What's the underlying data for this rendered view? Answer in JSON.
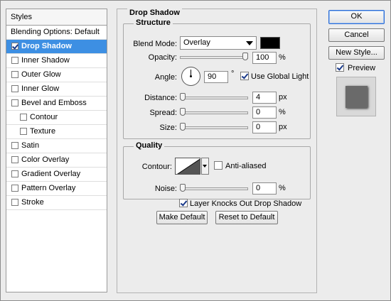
{
  "styles_panel": {
    "header": "Styles",
    "items": [
      {
        "label": "Blending Options: Default",
        "has_checkbox": false,
        "checked": false,
        "selected": false,
        "sub": false
      },
      {
        "label": "Drop Shadow",
        "has_checkbox": true,
        "checked": true,
        "selected": true,
        "sub": false
      },
      {
        "label": "Inner Shadow",
        "has_checkbox": true,
        "checked": false,
        "selected": false,
        "sub": false
      },
      {
        "label": "Outer Glow",
        "has_checkbox": true,
        "checked": false,
        "selected": false,
        "sub": false
      },
      {
        "label": "Inner Glow",
        "has_checkbox": true,
        "checked": false,
        "selected": false,
        "sub": false
      },
      {
        "label": "Bevel and Emboss",
        "has_checkbox": true,
        "checked": false,
        "selected": false,
        "sub": false
      },
      {
        "label": "Contour",
        "has_checkbox": true,
        "checked": false,
        "selected": false,
        "sub": true
      },
      {
        "label": "Texture",
        "has_checkbox": true,
        "checked": false,
        "selected": false,
        "sub": true
      },
      {
        "label": "Satin",
        "has_checkbox": true,
        "checked": false,
        "selected": false,
        "sub": false
      },
      {
        "label": "Color Overlay",
        "has_checkbox": true,
        "checked": false,
        "selected": false,
        "sub": false
      },
      {
        "label": "Gradient Overlay",
        "has_checkbox": true,
        "checked": false,
        "selected": false,
        "sub": false
      },
      {
        "label": "Pattern Overlay",
        "has_checkbox": true,
        "checked": false,
        "selected": false,
        "sub": false
      },
      {
        "label": "Stroke",
        "has_checkbox": true,
        "checked": false,
        "selected": false,
        "sub": false
      }
    ]
  },
  "drop_shadow": {
    "title": "Drop Shadow",
    "structure": {
      "title": "Structure",
      "blend_mode_label": "Blend Mode:",
      "blend_mode_value": "Overlay",
      "shadow_color": "#000000",
      "opacity_label": "Opacity:",
      "opacity_value": "100",
      "opacity_unit": "%",
      "opacity_fraction": 1.0,
      "angle_label": "Angle:",
      "angle_value": "90",
      "angle_unit": "°",
      "use_global_light_label": "Use Global Light",
      "use_global_light_checked": true,
      "distance_label": "Distance:",
      "distance_value": "4",
      "distance_unit": "px",
      "distance_fraction": 0.0,
      "spread_label": "Spread:",
      "spread_value": "0",
      "spread_unit": "%",
      "spread_fraction": 0.0,
      "size_label": "Size:",
      "size_value": "0",
      "size_unit": "px",
      "size_fraction": 0.0
    },
    "quality": {
      "title": "Quality",
      "contour_label": "Contour:",
      "anti_aliased_label": "Anti-aliased",
      "anti_aliased_checked": false,
      "noise_label": "Noise:",
      "noise_value": "0",
      "noise_unit": "%",
      "noise_fraction": 0.0
    },
    "layer_knocks_out_label": "Layer Knocks Out Drop Shadow",
    "layer_knocks_out_checked": true,
    "make_default_label": "Make Default",
    "reset_default_label": "Reset to Default"
  },
  "actions": {
    "ok_label": "OK",
    "cancel_label": "Cancel",
    "new_style_label": "New Style...",
    "preview_label": "Preview",
    "preview_checked": true
  },
  "colors": {
    "selection": "#3d8fe3",
    "dialog_bg": "#ececec"
  }
}
